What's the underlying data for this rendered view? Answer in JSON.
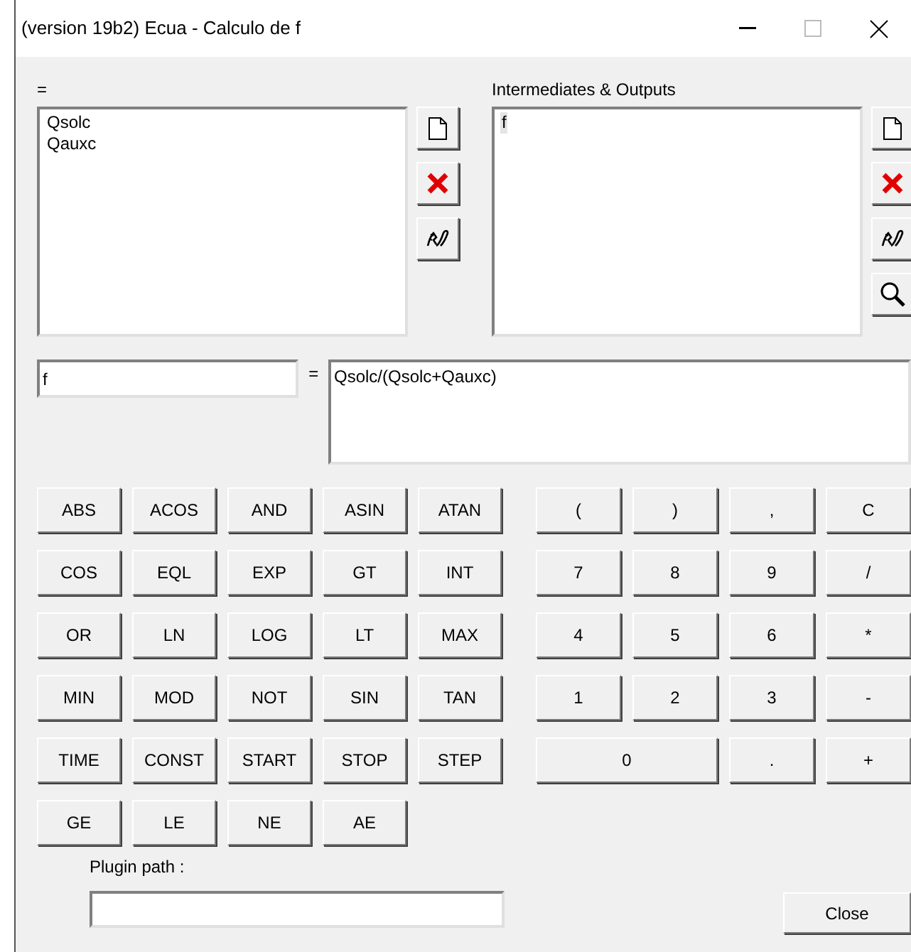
{
  "window": {
    "title": "(version 19b2) Ecua - Calculo de f"
  },
  "inputs_panel": {
    "label": "=",
    "items": [
      {
        "text": "Qsolc",
        "selected": false
      },
      {
        "text": "Qauxc",
        "selected": false
      }
    ],
    "tools": [
      {
        "kind": "new"
      },
      {
        "kind": "delete"
      },
      {
        "kind": "edit"
      }
    ]
  },
  "outputs_panel": {
    "label": "Intermediates & Outputs",
    "items": [
      {
        "text": "f",
        "selected": true
      }
    ],
    "tools": [
      {
        "kind": "new"
      },
      {
        "kind": "delete"
      },
      {
        "kind": "edit"
      },
      {
        "kind": "search"
      }
    ]
  },
  "equation": {
    "name": "f",
    "equals": "=",
    "expression": "Qsolc/(Qsolc+Qauxc)"
  },
  "functions": [
    "ABS",
    "ACOS",
    "AND",
    "ASIN",
    "ATAN",
    "COS",
    "EQL",
    "EXP",
    "GT",
    "INT",
    "OR",
    "LN",
    "LOG",
    "LT",
    "MAX",
    "MIN",
    "MOD",
    "NOT",
    "SIN",
    "TAN",
    "TIME",
    "CONST",
    "START",
    "STOP",
    "STEP",
    "GE",
    "LE",
    "NE",
    "AE"
  ],
  "keypad": [
    {
      "label": "(",
      "kind": "key"
    },
    {
      "label": ")",
      "kind": "key"
    },
    {
      "label": ",",
      "kind": "key"
    },
    {
      "label": "C",
      "kind": "key"
    },
    {
      "label": "7",
      "kind": "key"
    },
    {
      "label": "8",
      "kind": "key"
    },
    {
      "label": "9",
      "kind": "key"
    },
    {
      "label": "/",
      "kind": "key"
    },
    {
      "label": "4",
      "kind": "key"
    },
    {
      "label": "5",
      "kind": "key"
    },
    {
      "label": "6",
      "kind": "key"
    },
    {
      "label": "*",
      "kind": "key"
    },
    {
      "label": "1",
      "kind": "key"
    },
    {
      "label": "2",
      "kind": "key"
    },
    {
      "label": "3",
      "kind": "key"
    },
    {
      "label": "-",
      "kind": "key"
    },
    {
      "label": "0",
      "kind": "wide"
    },
    {
      "label": ".",
      "kind": "key"
    },
    {
      "label": "+",
      "kind": "key"
    }
  ],
  "plugin_path": {
    "label": "Plugin path :"
  },
  "buttons": [
    "Close"
  ]
}
